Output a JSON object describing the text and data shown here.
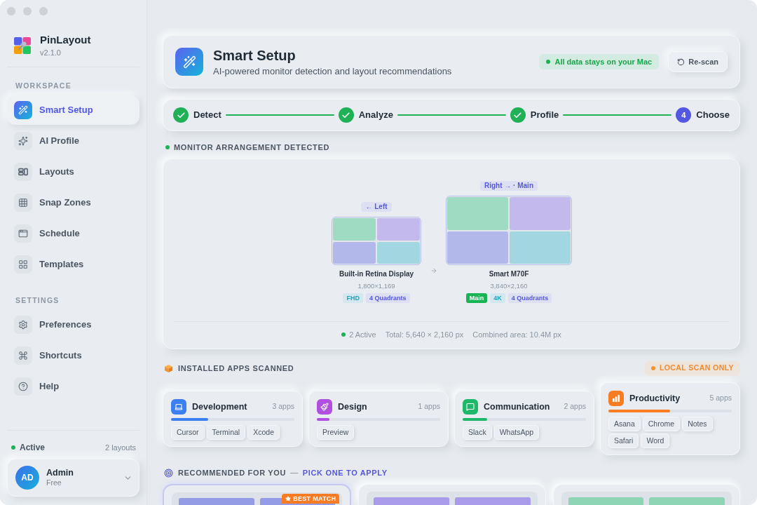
{
  "app": {
    "name": "PinLayout",
    "version": "v2.1.0"
  },
  "sidebar": {
    "sections": [
      {
        "title": "WORKSPACE",
        "items": [
          {
            "label": "Smart Setup",
            "selected": true
          },
          {
            "label": "AI Profile",
            "selected": false
          },
          {
            "label": "Layouts",
            "selected": false
          },
          {
            "label": "Snap Zones",
            "selected": false
          },
          {
            "label": "Schedule",
            "selected": false
          },
          {
            "label": "Templates",
            "selected": false
          }
        ]
      },
      {
        "title": "SETTINGS",
        "items": [
          {
            "label": "Preferences",
            "selected": false
          },
          {
            "label": "Shortcuts",
            "selected": false
          },
          {
            "label": "Help",
            "selected": false
          }
        ]
      }
    ],
    "status": {
      "label": "Active",
      "count": "2 layouts"
    },
    "user": {
      "initials": "AD",
      "name": "Admin",
      "plan": "Free"
    }
  },
  "header": {
    "title": "Smart Setup",
    "subtitle": "AI-powered monitor detection and layout recommendations",
    "privacy_note": "All data stays on your Mac",
    "rescan_button": "Re-scan"
  },
  "steps": [
    {
      "label": "Detect",
      "done": true
    },
    {
      "label": "Analyze",
      "done": true
    },
    {
      "label": "Profile",
      "done": true
    },
    {
      "label": "Choose",
      "number": "4",
      "done": false
    }
  ],
  "monitors": {
    "title": "MONITOR ARRANGEMENT DETECTED",
    "displays": [
      {
        "position": "← Left",
        "name": "Built-in Retina Display",
        "resolution": "1,800×1,169",
        "main": false,
        "zones": [
          {
            "color": "#9fdac2"
          },
          {
            "color": "#c4b9ed"
          },
          {
            "color": "#b2b8ea"
          },
          {
            "color": "#a2d7e1"
          }
        ],
        "tags": [
          {
            "label": "FHD",
            "kind": "resolution"
          },
          {
            "label": "4 Quadrants",
            "kind": "layout"
          }
        ]
      },
      {
        "position": "Right → · Main",
        "name": "Smart M70F",
        "resolution": "3,840×2,160",
        "main": true,
        "zones": [
          {
            "color": "#9fdac2"
          },
          {
            "color": "#c4b9ed"
          },
          {
            "color": "#b2b8ea"
          },
          {
            "color": "#a2d7e1"
          }
        ],
        "tags": [
          {
            "label": "Main",
            "kind": "main"
          },
          {
            "label": "4K",
            "kind": "resolution"
          },
          {
            "label": "4 Quadrants",
            "kind": "layout"
          }
        ]
      }
    ],
    "stats": {
      "active": "2 Active",
      "total": "Total: 5,640 × 2,160 px",
      "area": "Combined area: 10.4M px"
    }
  },
  "apps": {
    "title": "INSTALLED APPS SCANNED",
    "badge": "LOCAL SCAN ONLY",
    "categories": [
      {
        "name": "Development",
        "count": "3 apps",
        "level": 0.3,
        "color": "#3b7ff0",
        "apps": [
          "Cursor",
          "Terminal",
          "Xcode"
        ]
      },
      {
        "name": "Design",
        "count": "1 apps",
        "level": 0.1,
        "color": "#b04fe0",
        "apps": [
          "Preview"
        ]
      },
      {
        "name": "Communication",
        "count": "2 apps",
        "level": 0.2,
        "color": "#1fb86a",
        "apps": [
          "Slack",
          "WhatsApp"
        ]
      },
      {
        "name": "Productivity",
        "count": "5 apps",
        "level": 0.5,
        "color": "#f97b22",
        "apps": [
          "Asana",
          "Chrome",
          "Notes",
          "Safari",
          "Word"
        ]
      }
    ]
  },
  "recommendations": {
    "title": "RECOMMENDED FOR YOU",
    "separator": "—",
    "hint": "PICK ONE TO APPLY",
    "cards": [
      {
        "selected": true,
        "badge": "BEST MATCH",
        "zones": [
          {
            "color": "#959ce6"
          },
          {
            "color": "#959ce6"
          }
        ]
      },
      {
        "selected": false,
        "zones": [
          {
            "color": "#a99be9"
          },
          {
            "color": "#a99be9"
          }
        ]
      },
      {
        "selected": false,
        "zones": [
          {
            "color": "#8dd5b4"
          },
          {
            "color": "#8dd5b4"
          }
        ]
      }
    ]
  }
}
